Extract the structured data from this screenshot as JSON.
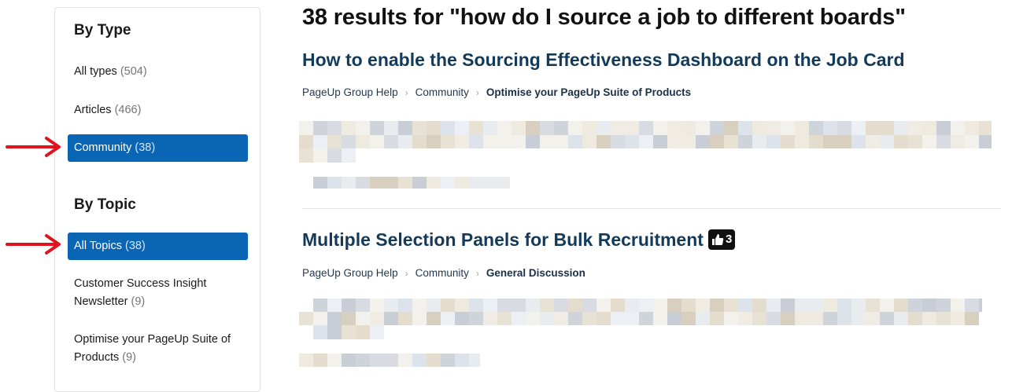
{
  "sidebar": {
    "by_type_heading": "By Type",
    "types": [
      {
        "label": "All types",
        "count": "(504)"
      },
      {
        "label": "Articles",
        "count": "(466)"
      },
      {
        "label": "Community",
        "count": "(38)"
      }
    ],
    "by_topic_heading": "By Topic",
    "topics": [
      {
        "label": "All Topics",
        "count": "(38)"
      },
      {
        "label_line1": "Customer Success Insight",
        "label_line2": "Newsletter",
        "count": "(9)"
      },
      {
        "label_line1": "Optimise your PageUp Suite of",
        "label_line2": "Products",
        "count": "(9)"
      }
    ]
  },
  "main": {
    "results_heading": "38 results for \"how do I source a job to different boards\"",
    "results": [
      {
        "title": "How to enable the Sourcing Effectiveness Dashboard on the Job Card",
        "breadcrumb": [
          "PageUp Group Help",
          "Community",
          "Optimise your PageUp Suite of Products"
        ]
      },
      {
        "title": "Multiple Selection Panels for Bulk Recruitment",
        "votes": "3",
        "breadcrumb": [
          "PageUp Group Help",
          "Community",
          "General Discussion"
        ]
      }
    ]
  },
  "colors": {
    "active_filter": "#0a66b4",
    "arrow": "#e0141e",
    "result_title": "#143a5a"
  },
  "icons": [
    "red-arrow-icon",
    "thumbs-up-icon",
    "chevron-right-icon"
  ]
}
